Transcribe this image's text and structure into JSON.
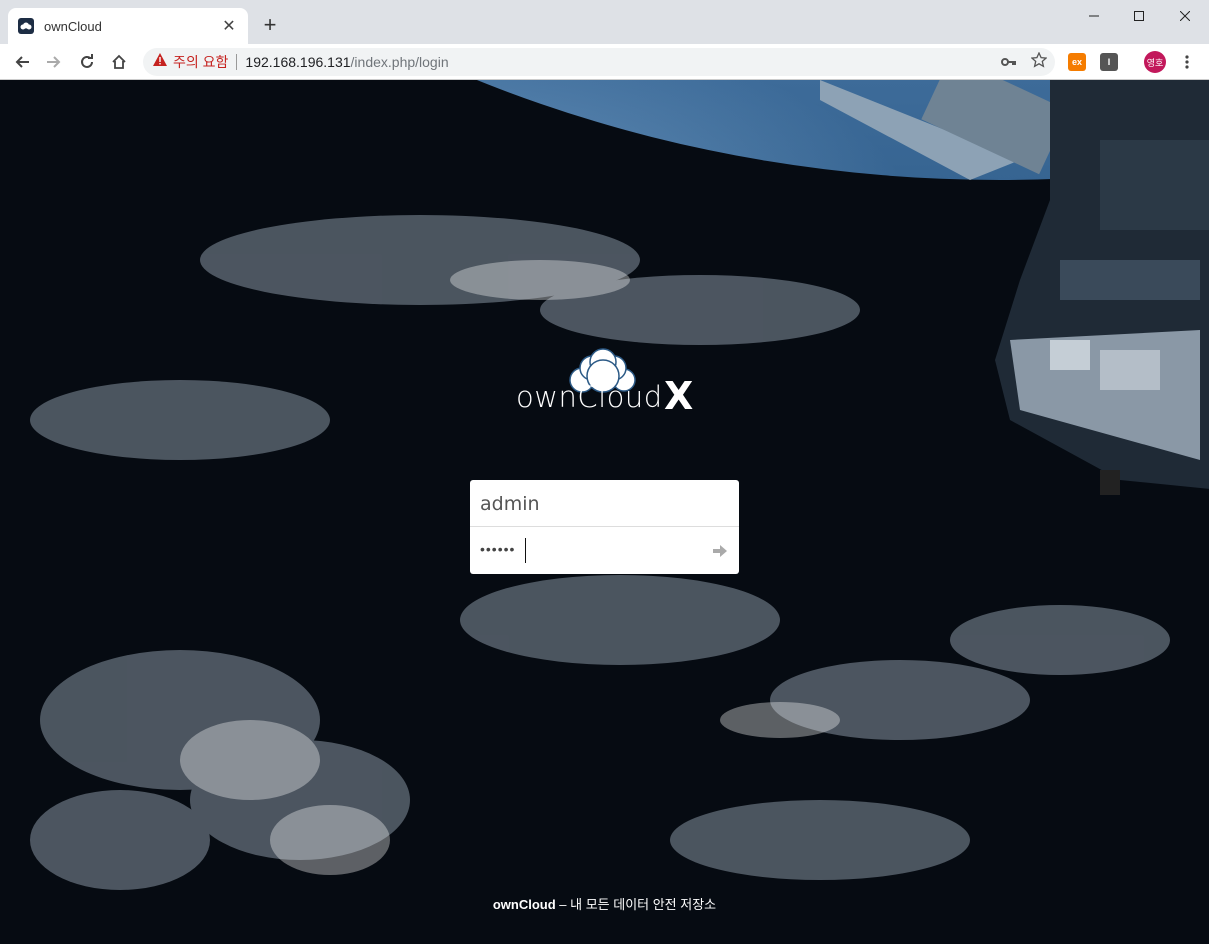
{
  "browser": {
    "tab_title": "ownCloud",
    "new_tab_label": "+",
    "security_warning": "주의 요함",
    "url_host": "192.168.196.131",
    "url_path": "/index.php/login",
    "profile_initials": "영호"
  },
  "page": {
    "logo_text": "ownCloud",
    "logo_version": "X",
    "username_value": "admin",
    "password_masked": "••••••",
    "footer_brand": "ownCloud",
    "footer_tagline": " – 내 모든 데이터 안전 저장소"
  },
  "colors": {
    "warning_red": "#c5221f",
    "omnibox_bg": "#f1f3f4",
    "page_blue": "#2c5a86"
  }
}
